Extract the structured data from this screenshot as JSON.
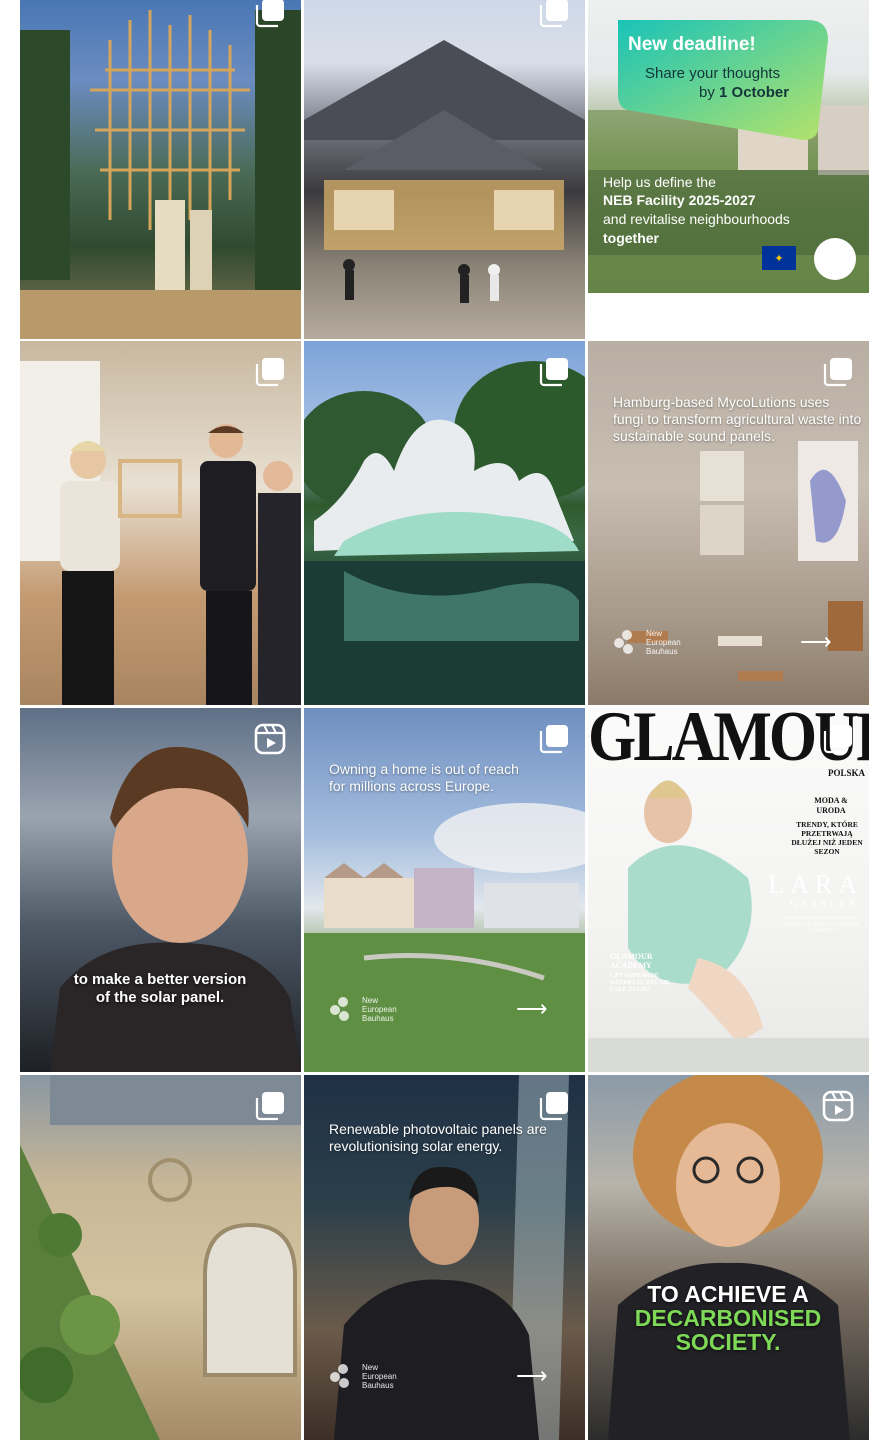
{
  "posts": [
    {
      "type": "carousel",
      "alt": ""
    },
    {
      "type": "carousel",
      "alt": ""
    },
    {
      "type": "image",
      "headline": "New deadline!",
      "line1": "Share your thoughts",
      "line2_prefix": "by ",
      "line2_bold": "1 October",
      "body1": "Help us define the",
      "body2": "NEB Facility 2025-2027",
      "body3": "and revitalise neighbourhoods",
      "body4": "together"
    },
    {
      "type": "carousel"
    },
    {
      "type": "carousel"
    },
    {
      "type": "carousel",
      "caption": "Hamburg-based MycoLutions uses fungi to transform agricultural waste into sustainable sound panels.",
      "logo_text": "New European Bauhaus"
    },
    {
      "type": "reel",
      "subtitle": "to make a better version of the solar panel."
    },
    {
      "type": "carousel",
      "caption": "Owning a home is out of reach for millions across Europe.",
      "logo_text": "New European Bauhaus"
    },
    {
      "type": "carousel",
      "masthead": "GLAMOUR",
      "edition": "POLSKA",
      "side_heading": "MODA & URODA",
      "side_text": "TRENDY, KTÓRE PRZETRWAJĄ DŁUŻEJ NIŻ JEDEN SEZON",
      "name_first": "LARA",
      "name_last": "GESSLER",
      "small_text": "Zawsze marzyłam o dwóch rzeczach: chciałam mieć dzieci i być niezależna od mężczyzn",
      "academy_title": "GLAMOUR ACADEMY",
      "academy_text": "CZY NAPRAWDĘ MUSIMY UCZYĆ SIĘ CAŁE ŻYCIE?"
    },
    {
      "type": "carousel"
    },
    {
      "type": "carousel",
      "caption": "Renewable photovoltaic panels are revolutionising solar energy.",
      "logo_text": "New European Bauhaus"
    },
    {
      "type": "reel",
      "subtitle_white": "TO ACHIEVE A",
      "subtitle_green1": "DECARBONISED",
      "subtitle_green2": "SOCIETY."
    }
  ],
  "colors": {
    "neb_green": "#7ed957",
    "neb_teal": "#19c3b8",
    "eu_blue": "#003399",
    "eu_yellow": "#ffcc00"
  },
  "icons": {
    "carousel": "multiple-images-icon",
    "reel": "reel-play-icon"
  }
}
